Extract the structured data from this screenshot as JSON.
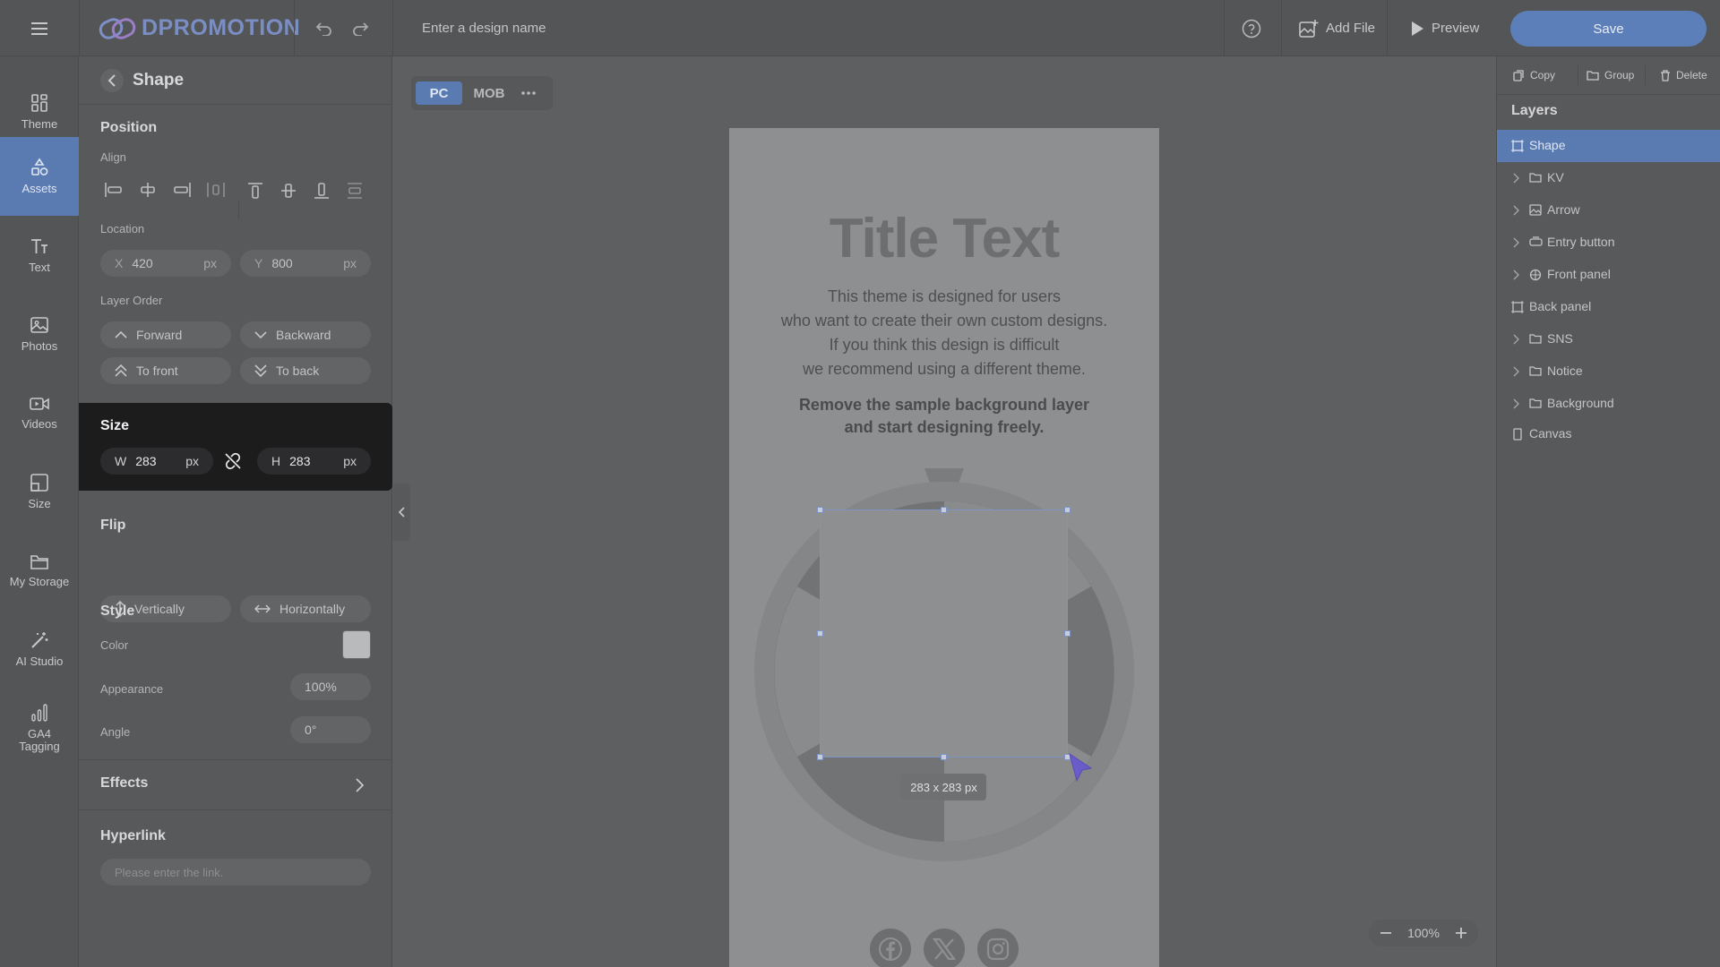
{
  "topbar": {
    "logo": "DPROMOTION",
    "design_name_placeholder": "Enter a design name",
    "add_file": "Add File",
    "preview": "Preview",
    "save": "Save"
  },
  "nav": {
    "items": [
      {
        "label": "Theme",
        "icon": "theme-icon"
      },
      {
        "label": "Assets",
        "icon": "assets-icon",
        "active": true
      },
      {
        "label": "Text",
        "icon": "text-icon"
      },
      {
        "label": "Photos",
        "icon": "photos-icon"
      },
      {
        "label": "Videos",
        "icon": "videos-icon"
      },
      {
        "label": "Size",
        "icon": "size-icon"
      },
      {
        "label": "My Storage",
        "icon": "storage-icon"
      },
      {
        "label": "AI Studio",
        "icon": "ai-studio-icon"
      },
      {
        "label": "GA4 Tagging",
        "icon": "analytics-icon"
      }
    ]
  },
  "props": {
    "header": "Shape",
    "position_title": "Position",
    "align_label": "Align",
    "location_label": "Location",
    "x_label": "X",
    "x_value": "420",
    "y_label": "Y",
    "y_value": "800",
    "unit": "px",
    "layer_order_label": "Layer Order",
    "forward": "Forward",
    "backward": "Backward",
    "to_front": "To front",
    "to_back": "To back",
    "size_title": "Size",
    "w_label": "W",
    "w_value": "283",
    "h_label": "H",
    "h_value": "283",
    "flip_title": "Flip",
    "vertically": "Vertically",
    "horizontally": "Horizontally",
    "style_title": "Style",
    "color_label": "Color",
    "color_value": "#b9babc",
    "appearance_label": "Appearance",
    "appearance_value": "100%",
    "angle_label": "Angle",
    "angle_value": "0°",
    "effects_title": "Effects",
    "hyperlink_title": "Hyperlink",
    "hyperlink_placeholder": "Please enter the link."
  },
  "canvas": {
    "pc": "PC",
    "mob": "MOB",
    "title": "Title Text",
    "body_lines": [
      "This theme is designed for users",
      "who want to create their own custom designs.",
      "If you think this design is difficult",
      "we recommend using a different theme."
    ],
    "bold_lines": [
      "Remove the sample background layer",
      "and start designing freely."
    ],
    "size_tag": "283 x 283 px",
    "zoom": "100%"
  },
  "right": {
    "copy": "Copy",
    "group": "Group",
    "delete": "Delete",
    "layers_title": "Layers",
    "layers": [
      {
        "label": "Shape",
        "icon": "shape-icon",
        "active": true,
        "expandable": false
      },
      {
        "label": "KV",
        "icon": "folder-icon",
        "expandable": true
      },
      {
        "label": "Arrow",
        "icon": "image-icon",
        "expandable": true
      },
      {
        "label": "Entry button",
        "icon": "button-icon",
        "expandable": true
      },
      {
        "label": "Front panel",
        "icon": "component-icon",
        "expandable": true
      },
      {
        "label": "Back panel",
        "icon": "shape-icon",
        "expandable": false
      },
      {
        "label": "SNS",
        "icon": "folder-icon",
        "expandable": true
      },
      {
        "label": "Notice",
        "icon": "folder-icon",
        "expandable": true
      },
      {
        "label": "Background",
        "icon": "folder-icon",
        "expandable": true
      },
      {
        "label": "Canvas",
        "icon": "canvas-icon",
        "expandable": false
      }
    ]
  },
  "colors": {
    "accent": "#5a7bb2",
    "save": "#5c7fb9",
    "selection": "#7d93c4",
    "cursor": "#6a5cc9"
  }
}
